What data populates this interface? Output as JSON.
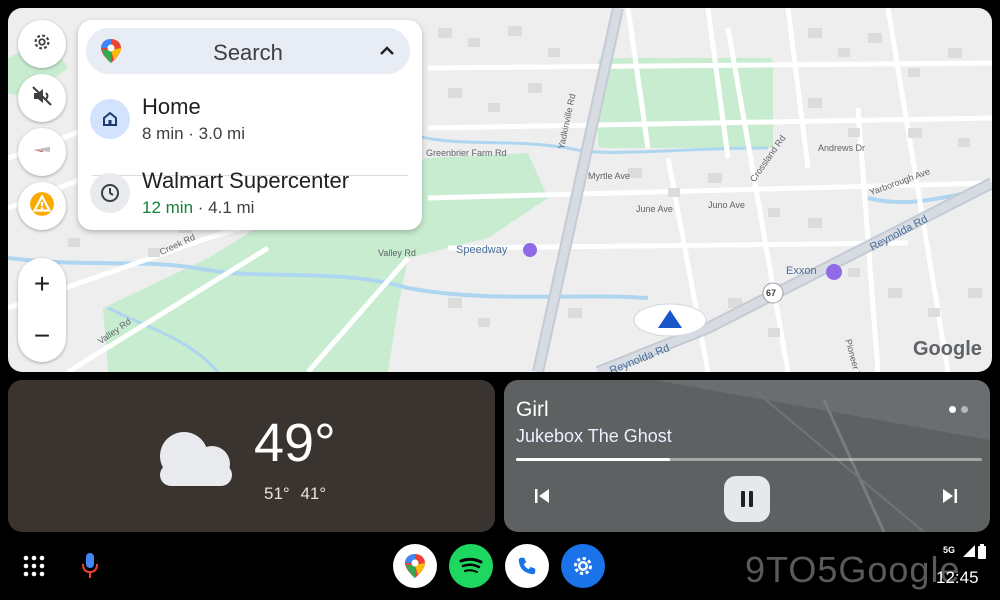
{
  "map": {
    "labels": {
      "greenbrier_farm_rd": "Greenbrier Farm Rd",
      "myrtle_ave": "Myrtle Ave",
      "june_ave": "June Ave",
      "juno_ave": "Juno Ave",
      "valley_rd": "Valley Rd",
      "valley_rd_2": "Valley Rd",
      "speedway": "Speedway",
      "exxon": "Exxon",
      "yadkinville_rd": "Yadkinville Rd",
      "reynolda_rd": "Reynolda Rd",
      "reynolda_rd_2": "Reynolda Rd",
      "creek_rd": "Creek Rd",
      "crossland_rd": "Crossland Rd",
      "andrews_dr": "Andrews Dr",
      "yarborough_ave": "Yarborough Ave",
      "pioneer_trl": "Pioneer Trl",
      "route_67": "67",
      "google_logo": "Google"
    }
  },
  "controls": {
    "settings_icon": "gear-icon",
    "mute_icon": "volume-off-icon",
    "compass_icon": "compass-icon",
    "report_icon": "warning-icon",
    "zoom_in_label": "+",
    "zoom_out_label": "−"
  },
  "search_card": {
    "search_label": "Search",
    "destinations": [
      {
        "name": "Home",
        "time": "",
        "meta": "8 min · 3.0 mi",
        "icon": "home-icon"
      },
      {
        "name": "Walmart Supercenter",
        "time": "12 min",
        "meta": " · 4.1 mi",
        "icon": "clock-icon"
      }
    ]
  },
  "weather": {
    "temperature": "49°",
    "high": "51°",
    "low": "41°",
    "icon": "cloud-icon"
  },
  "media": {
    "song": "Girl",
    "artist": "Jukebox The Ghost",
    "progress": 0.33,
    "page_dots": 2,
    "active_dot": 0
  },
  "dock": {
    "apps": [
      "maps-app-icon",
      "spotify-app-icon",
      "phone-app-icon",
      "settings-app-icon"
    ],
    "launcher_icon": "app-grid-icon",
    "mic_icon": "microphone-icon"
  },
  "status": {
    "network": "5G",
    "time": "12:45"
  },
  "watermark": "9TO5Google",
  "colors": {
    "weather_bg": "#3a3431",
    "media_bg": "#5d6162",
    "accent_blue": "#1a73e8",
    "eta_green": "#188038",
    "park_green": "#c8ecd0",
    "river_blue": "#aed6f1"
  }
}
